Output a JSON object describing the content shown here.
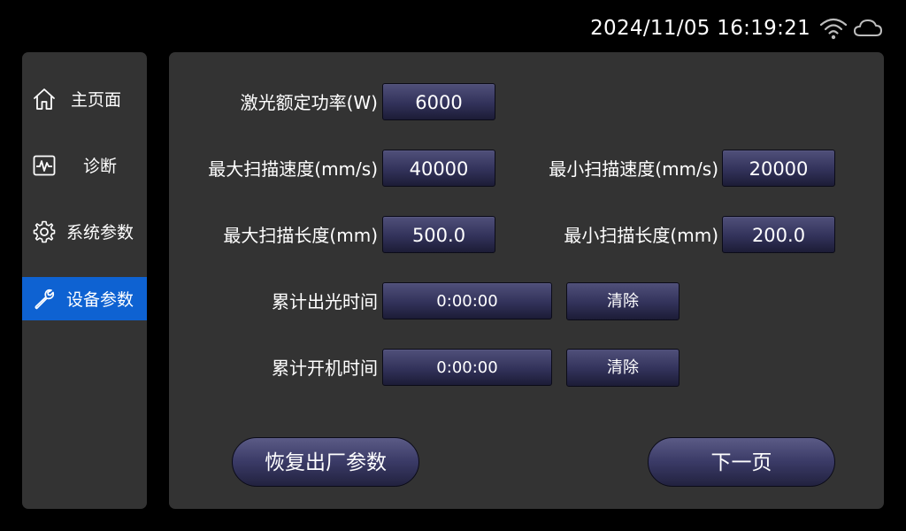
{
  "status": {
    "datetime": "2024/11/05 16:19:21",
    "wifi_icon": "wifi-icon",
    "cloud_icon": "cloud-icon"
  },
  "sidebar": {
    "items": [
      {
        "label": "主页面",
        "icon": "home-icon"
      },
      {
        "label": "诊断",
        "icon": "waveform-icon"
      },
      {
        "label": "系统参数",
        "icon": "gear-icon"
      },
      {
        "label": "设备参数",
        "icon": "wrench-icon",
        "active": true
      }
    ],
    "active_color": "#0e62d2"
  },
  "form": {
    "rated_power": {
      "label": "激光额定功率(W)",
      "value": "6000"
    },
    "max_scan_speed": {
      "label": "最大扫描速度(mm/s)",
      "value": "40000"
    },
    "min_scan_speed": {
      "label": "最小扫描速度(mm/s)",
      "value": "20000"
    },
    "max_scan_length": {
      "label": "最大扫描长度(mm)",
      "value": "500.0"
    },
    "min_scan_length": {
      "label": "最小扫描长度(mm)",
      "value": "200.0"
    },
    "total_emission_time": {
      "label": "累计出光时间",
      "value": "0:00:00",
      "clear_label": "清除"
    },
    "total_power_on_time": {
      "label": "累计开机时间",
      "value": "0:00:00",
      "clear_label": "清除"
    }
  },
  "actions": {
    "restore_defaults": "恢复出厂参数",
    "next_page": "下一页"
  }
}
